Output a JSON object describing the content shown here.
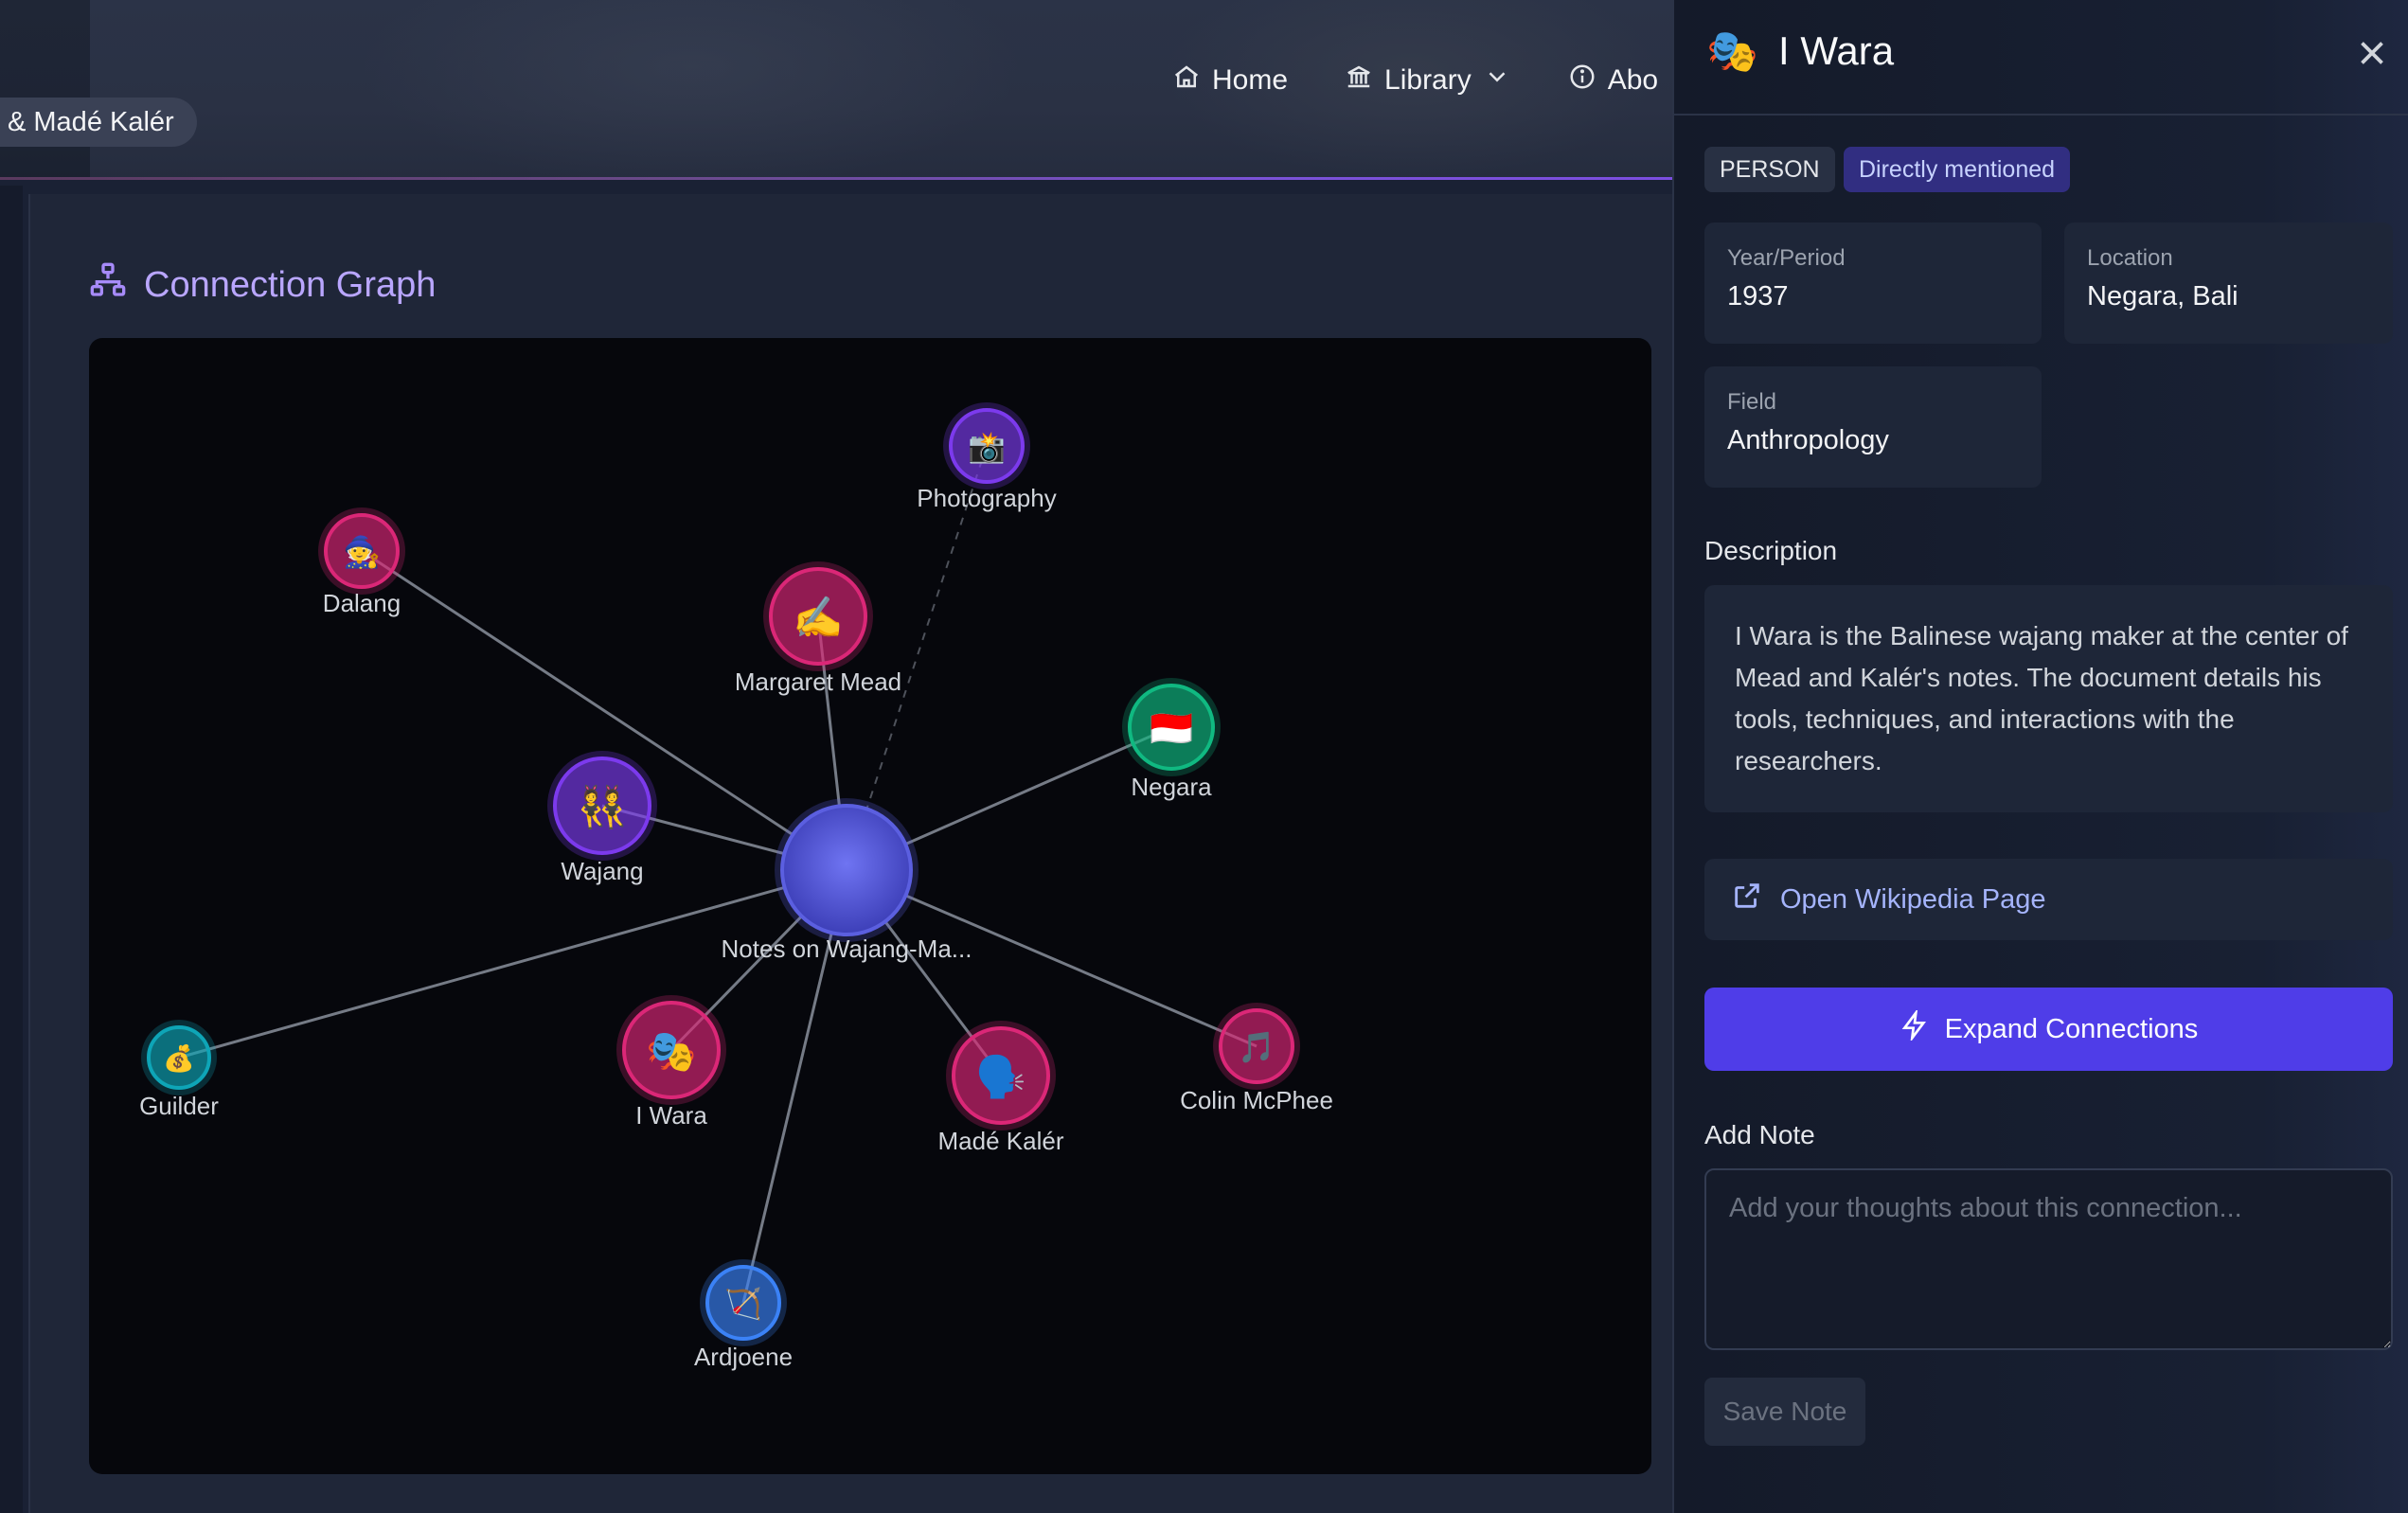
{
  "breadcrumb": {
    "text": "& Madé Kalér"
  },
  "nav": {
    "home": "Home",
    "library": "Library",
    "about": "Abo"
  },
  "graph": {
    "title": "Connection Graph",
    "nodes": [
      {
        "id": "center",
        "label": "Notes on Wajang-Ma...",
        "emoji": "",
        "color": "#5b5fe0"
      },
      {
        "id": "photography",
        "label": "Photography",
        "emoji": "📸",
        "color": "#7c3aed"
      },
      {
        "id": "dalang",
        "label": "Dalang",
        "emoji": "🧙",
        "color": "#db2777"
      },
      {
        "id": "margaret",
        "label": "Margaret Mead",
        "emoji": "✍️",
        "color": "#db2777"
      },
      {
        "id": "negara",
        "label": "Negara",
        "emoji": "🇮🇩",
        "color": "#10b981"
      },
      {
        "id": "wajang",
        "label": "Wajang",
        "emoji": "👯",
        "color": "#7c3aed"
      },
      {
        "id": "guilder",
        "label": "Guilder",
        "emoji": "💰",
        "color": "#0ea5b7"
      },
      {
        "id": "iwara",
        "label": "I Wara",
        "emoji": "🎭",
        "color": "#db2777"
      },
      {
        "id": "made",
        "label": "Madé Kalér",
        "emoji": "🗣️",
        "color": "#db2777"
      },
      {
        "id": "colin",
        "label": "Colin McPhee",
        "emoji": "🎵",
        "color": "#db2777"
      },
      {
        "id": "ardjoene",
        "label": "Ardjoene",
        "emoji": "🏹",
        "color": "#3b82f6"
      }
    ]
  },
  "drawer": {
    "emoji": "🎭",
    "title": "I Wara",
    "type_badge": "PERSON",
    "mention_badge": "Directly mentioned",
    "year_label": "Year/Period",
    "year_value": "1937",
    "location_label": "Location",
    "location_value": "Negara, Bali",
    "field_label": "Field",
    "field_value": "Anthropology",
    "description_label": "Description",
    "description": "I Wara is the Balinese wajang maker at the center of Mead and Kalér's notes. The document details his tools, techniques, and interactions with the researchers.",
    "wiki_label": "Open Wikipedia Page",
    "expand_label": "Expand Connections",
    "note_label": "Add Note",
    "note_placeholder": "Add your thoughts about this connection...",
    "save_label": "Save Note"
  }
}
